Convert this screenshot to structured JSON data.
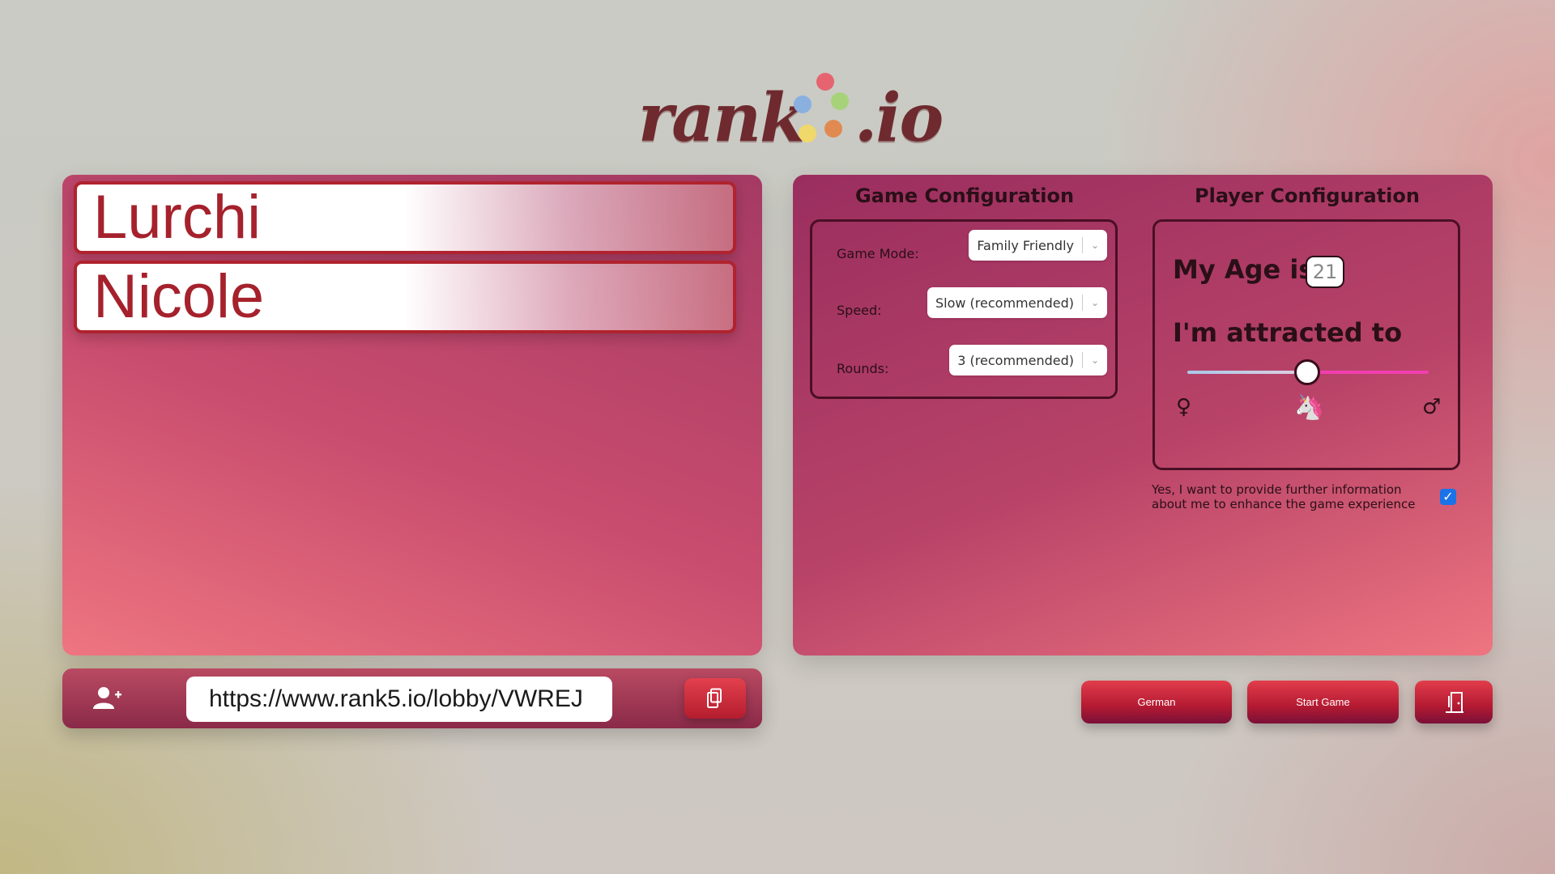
{
  "logo": {
    "text_main": "rank",
    "text_suffix": ".io",
    "dot_colors": [
      "#e56470",
      "#8ab0e0",
      "#a8d27a",
      "#f0d86a",
      "#e08a52"
    ]
  },
  "players": [
    {
      "name": "Lurchi"
    },
    {
      "name": "Nicole"
    }
  ],
  "game_config": {
    "title": "Game Configuration",
    "game_mode": {
      "label": "Game Mode:",
      "value": "Family Friendly"
    },
    "speed": {
      "label": "Speed:",
      "value": "Slow (recommended)"
    },
    "rounds": {
      "label": "Rounds:",
      "value": "3 (recommended)"
    }
  },
  "player_config": {
    "title": "Player Configuration",
    "age_label": "My Age is",
    "age_value": "21",
    "attraction_label": "I'm attracted to",
    "attraction_slider_fraction": 0.5,
    "female_symbol": "♀",
    "unicorn_symbol": "🦄",
    "male_symbol": "♂"
  },
  "info_consent": {
    "text": "Yes, I want to provide further information about me to enhance the game experience",
    "checked": true
  },
  "invite": {
    "url": "https://www.rank5.io/lobby/VWREJ",
    "add_user_icon": "add-user-icon",
    "copy_icon": "copy-icon"
  },
  "actions": {
    "language_label": "German",
    "start_label": "Start Game",
    "exit_icon": "exit-door-icon"
  },
  "colors": {
    "accent_red": "#b0232e",
    "panel_magenta": "#b84368",
    "slider_pink": "#f23eb0",
    "checkbox_blue": "#1a73e8"
  }
}
